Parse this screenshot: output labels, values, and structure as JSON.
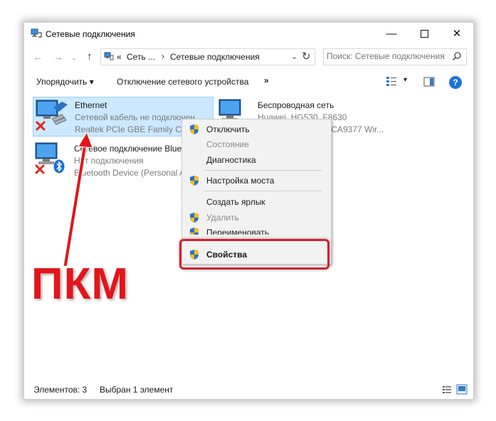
{
  "window": {
    "title": "Сетевые подключения",
    "minimize_glyph": "—",
    "close_glyph": "✕"
  },
  "address": {
    "back_glyph": "←",
    "forward_glyph": "→",
    "history_glyph": "⌄",
    "up_glyph": "↑",
    "crumb_prefix": "«",
    "crumb_1": "Сеть ...",
    "separator": "›",
    "crumb_2": "Сетевые подключения",
    "dropdown_glyph": "⌄",
    "refresh_glyph": "↻",
    "search_placeholder": "Поиск: Сетевые подключения"
  },
  "toolbar": {
    "organize": "Упорядочить ▾",
    "disable_device": "Отключение сетевого устройства",
    "more": "»",
    "view_dropdown": "▾",
    "help": "?"
  },
  "connections": [
    {
      "name": "Ethernet",
      "status": "Сетевой кабель не подключен",
      "device": "Realtek PCIe GBE Family Controller"
    },
    {
      "name": "Сетевое подключение Bluetooth",
      "status": "Нет подключения",
      "device": "Bluetooth Device (Personal Area Network)"
    },
    {
      "name": "Беспроводная сеть",
      "status": "Huawei_HG530_F8630",
      "device": "QCA9377 Wir..."
    }
  ],
  "context_menu": [
    {
      "label": "Отключить",
      "shield": true,
      "disabled": false
    },
    {
      "label": "Состояние",
      "shield": false,
      "disabled": true
    },
    {
      "label": "Диагностика",
      "shield": false,
      "disabled": false
    },
    {
      "label": "Настройка моста",
      "shield": true,
      "disabled": false
    },
    {
      "label": "Создать ярлык",
      "shield": false,
      "disabled": false
    },
    {
      "label": "Удалить",
      "shield": true,
      "disabled": true
    },
    {
      "label": "Переименовать",
      "shield": true,
      "disabled": false
    },
    {
      "label": "Свойства",
      "shield": true,
      "disabled": false
    }
  ],
  "statusbar": {
    "count": "Элементов: 3",
    "selected": "Выбран 1 элемент"
  },
  "annotation": {
    "label": "ПКМ",
    "color": "#e3151b"
  },
  "colors": {
    "selection": "#cce8ff",
    "highlight_border": "#d42027",
    "help_blue": "#1e73d8"
  }
}
